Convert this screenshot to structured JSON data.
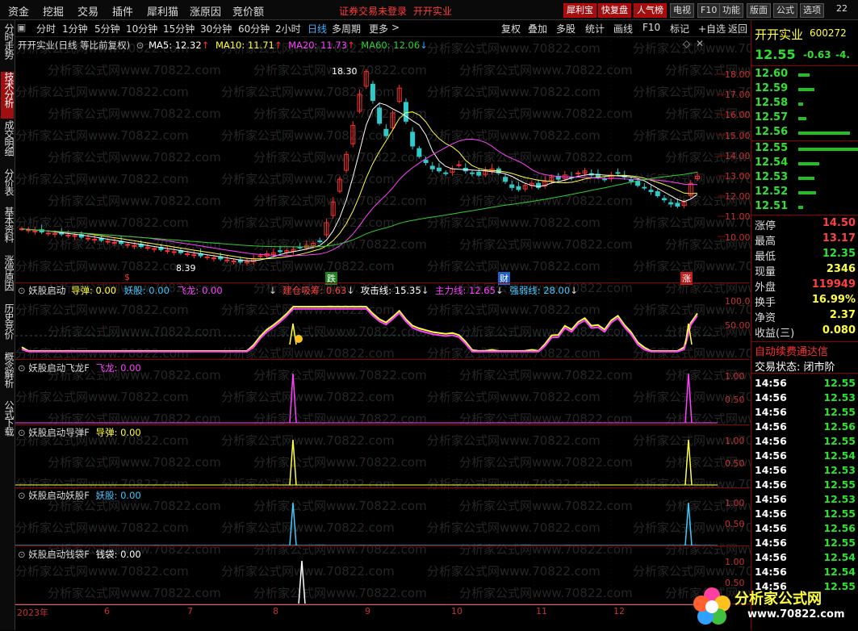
{
  "menubar": {
    "items": [
      "资金",
      "挖掘",
      "交易",
      "插件",
      "犀利猫",
      "涨原因",
      "竞价额"
    ],
    "notice": "证券交易未登录",
    "stock_title": "开开实业",
    "tools": [
      "犀利宝",
      "快复盘",
      "人气榜",
      "电视",
      "F10",
      "功能",
      "版面",
      "公式",
      "选项"
    ],
    "corner": "22"
  },
  "left_tabs": [
    "分时走势",
    "技术分析",
    "成交明细",
    "分价表",
    "基本资料",
    "涨停原因",
    "历史竞价",
    "概念解析",
    "公式下载"
  ],
  "periods": [
    "分时",
    "1分钟",
    "5分钟",
    "10分钟",
    "15分钟",
    "30分钟",
    "60分钟",
    "2小时",
    "日线",
    "多周期",
    "更多"
  ],
  "active_period": "日线",
  "right_buttons": [
    "复权",
    "叠加",
    "多股",
    "统计",
    "画线",
    "F10",
    "标记",
    "+自选",
    "返回"
  ],
  "main_chart": {
    "title": "开开实业(日线 等比前复权)",
    "ma": [
      {
        "label": "MA5: 12.32",
        "color": "#ffffff"
      },
      {
        "label": "MA10: 11.71",
        "color": "#ffff40"
      },
      {
        "label": "MA20: 11.73",
        "color": "#ff40ff"
      },
      {
        "label": "MA60: 12.06",
        "color": "#30d030"
      }
    ],
    "high_mark": "18.30",
    "low_mark": "8.39",
    "y_ticks": [
      "18.00",
      "17.00",
      "16.00",
      "15.00",
      "14.00",
      "13.00",
      "12.00",
      "11.00",
      "10.00"
    ],
    "markers": [
      {
        "text": "$",
        "color": "#ff3030"
      },
      {
        "text": "跌",
        "color": "#30c030"
      },
      {
        "text": "财",
        "color": "#3090ff"
      },
      {
        "text": "涨",
        "color": "#ff3030"
      }
    ]
  },
  "chart_data": [
    {
      "type": "candlestick",
      "title": "开开实业(日线 等比前复权)",
      "ylim": [
        10.0,
        18.3
      ],
      "close": [
        10.0,
        9.95,
        9.9,
        9.85,
        9.8,
        9.78,
        9.75,
        9.7,
        9.68,
        9.6,
        9.55,
        9.5,
        9.45,
        9.4,
        9.35,
        9.3,
        9.25,
        9.2,
        9.15,
        9.1,
        9.05,
        9.0,
        8.95,
        8.9,
        8.85,
        8.8,
        8.75,
        8.7,
        8.65,
        8.6,
        8.55,
        8.5,
        8.45,
        8.4,
        8.42,
        8.55,
        8.7,
        8.8,
        8.85,
        8.9,
        8.95,
        9.0,
        9.1,
        9.2,
        9.3,
        9.4,
        10.3,
        11.3,
        12.4,
        13.6,
        15.0,
        16.5,
        17.6,
        16.2,
        15.1,
        14.5,
        15.6,
        16.8,
        15.2,
        14.0,
        13.5,
        13.2,
        12.9,
        12.8,
        12.7,
        12.9,
        13.1,
        12.8,
        12.7,
        12.6,
        12.8,
        12.9,
        12.7,
        12.3,
        12.0,
        11.9,
        12.1,
        12.2,
        12.0,
        12.3,
        12.5,
        12.4,
        12.6,
        12.5,
        12.7,
        12.8,
        12.6,
        12.5,
        12.4,
        12.6,
        12.7,
        12.5,
        12.3,
        12.1,
        12.0,
        11.8,
        11.6,
        11.4,
        11.2,
        11.1,
        11.3,
        12.2,
        12.55
      ],
      "high_label": 18.3,
      "low_label": 8.39
    },
    {
      "type": "line",
      "title": "妖股启动",
      "ylim": [
        0,
        100
      ],
      "series": [
        {
          "name": "建仓吸筹",
          "color": "#ff40ff"
        },
        {
          "name": "攻击线",
          "color": "#ffffff"
        },
        {
          "name": "主力线",
          "color": "#ffff40"
        }
      ]
    }
  ],
  "ind1": {
    "name": "妖股启动",
    "items": [
      {
        "label": "导弹: 0.00",
        "color": "#ffff40"
      },
      {
        "label": "妖股: 0.00",
        "color": "#40c8ff"
      },
      {
        "label": "飞龙: 0.00",
        "color": "#ff40ff"
      },
      {
        "label": "建仓吸筹: 0.63",
        "color": "#ff4040"
      },
      {
        "label": "攻击线: 15.35",
        "color": "#ffffff"
      },
      {
        "label": "主力线: 12.65",
        "color": "#ff40ff"
      },
      {
        "label": "强弱线: 28.00",
        "color": "#40c8ff"
      }
    ],
    "y_ticks": [
      "100.0",
      "50.00"
    ]
  },
  "ind2": {
    "name": "妖股启动飞龙F",
    "label": "飞龙: 0.00",
    "color": "#ff40ff",
    "y_ticks": [
      "1.00",
      "0.50"
    ]
  },
  "ind3": {
    "name": "妖股启动导弹F",
    "label": "导弹: 0.00",
    "color": "#ffff40",
    "y_ticks": [
      "1.00",
      "0.50"
    ]
  },
  "ind4": {
    "name": "妖股启动妖股F",
    "label": "妖股: 0.00",
    "color": "#40c8ff",
    "y_ticks": [
      "1.00",
      "0.50"
    ]
  },
  "ind5": {
    "name": "妖股启动钱袋F",
    "label": "钱袋: 0.00",
    "color": "#ffffff",
    "y_ticks": [
      "1.00",
      "0.50"
    ]
  },
  "x_axis": [
    "2023年",
    "6",
    "7",
    "8",
    "9",
    "10",
    "11",
    "12"
  ],
  "quote": {
    "name": "开开实业",
    "code": "600272",
    "price": "12.55",
    "change": "-0.63",
    "pct": "-4.",
    "asks": [
      {
        "price": "12.60",
        "bar": 14
      },
      {
        "price": "12.59",
        "bar": 20
      },
      {
        "price": "12.58",
        "bar": 6
      },
      {
        "price": "12.57",
        "bar": 10
      },
      {
        "price": "12.56",
        "bar": 64
      }
    ],
    "bids": [
      {
        "price": "12.55",
        "bar": 84
      },
      {
        "price": "12.54",
        "bar": 26
      },
      {
        "price": "12.53",
        "bar": 20
      },
      {
        "price": "12.52",
        "bar": 22
      },
      {
        "price": "12.51",
        "bar": 6
      }
    ],
    "stats": [
      {
        "label": "涨停",
        "value": "14.50",
        "color": "#ff4040"
      },
      {
        "label": "最高",
        "value": "13.17",
        "color": "#ff4040"
      },
      {
        "label": "最低",
        "value": "12.35",
        "color": "#30e030"
      },
      {
        "label": "现量",
        "value": "2346",
        "color": "#ffff40"
      },
      {
        "label": "外盘",
        "value": "119949",
        "color": "#ff4040"
      },
      {
        "label": "换手",
        "value": "16.99%",
        "color": "#ffff40"
      },
      {
        "label": "净资",
        "value": "2.37",
        "color": "#ffff40"
      },
      {
        "label": "收益(三)",
        "value": "0.080",
        "color": "#ffff40"
      }
    ],
    "notice_red": "自动续费通达信",
    "status": "交易状态: 闭市阶",
    "ticks": [
      {
        "time": "14:56",
        "price": "12.55",
        "color": "#30e030"
      },
      {
        "time": "14:56",
        "price": "12.53",
        "color": "#30e030"
      },
      {
        "time": "14:56",
        "price": "12.55",
        "color": "#30e030"
      },
      {
        "time": "14:56",
        "price": "12.56",
        "color": "#30e030"
      },
      {
        "time": "14:56",
        "price": "12.55",
        "color": "#30e030"
      },
      {
        "time": "14:56",
        "price": "12.54",
        "color": "#30e030"
      },
      {
        "time": "14:56",
        "price": "12.53",
        "color": "#30e030"
      },
      {
        "time": "14:56",
        "price": "12.55",
        "color": "#30e030"
      },
      {
        "time": "14:56",
        "price": "12.53",
        "color": "#30e030"
      },
      {
        "time": "14:56",
        "price": "12.55",
        "color": "#30e030"
      },
      {
        "time": "14:56",
        "price": "12.56",
        "color": "#30e030"
      },
      {
        "time": "14:56",
        "price": "12.55",
        "color": "#30e030"
      },
      {
        "time": "14:56",
        "price": "12.54",
        "color": "#30e030"
      },
      {
        "time": "14:56",
        "price": "12.54",
        "color": "#30e030"
      },
      {
        "time": "14:56",
        "price": "12.55",
        "color": "#30e030"
      }
    ]
  },
  "watermark": {
    "line": "分析家公式网www.70822.com",
    "logo_text": "分析家公式网",
    "logo_url": "www.70822.com"
  }
}
